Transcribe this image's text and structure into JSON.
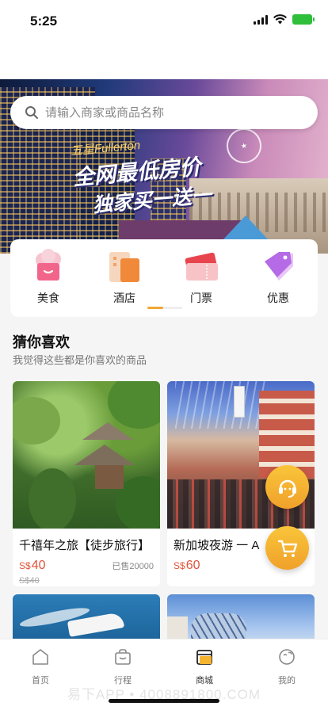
{
  "status": {
    "time": "5:25"
  },
  "banner": {
    "brand": "五星Fullerton",
    "line1": "全网最低房价",
    "line2": "独家买一送一"
  },
  "search": {
    "placeholder": "请输入商家或商品名称"
  },
  "categories": [
    {
      "label": "美食",
      "icon": "food-icon"
    },
    {
      "label": "酒店",
      "icon": "hotel-icon"
    },
    {
      "label": "门票",
      "icon": "ticket-icon"
    },
    {
      "label": "优惠",
      "icon": "coupon-icon"
    }
  ],
  "section": {
    "title": "猜你喜欢",
    "subtitle": "我觉得这些都是你喜欢的商品"
  },
  "products": [
    {
      "title": "千禧年之旅【徒步旅行】",
      "currency": "S$",
      "price": "40",
      "sold": "已售20000",
      "original": "S$40"
    },
    {
      "title": "新加坡夜游 一 A",
      "currency": "S$",
      "price": "60"
    }
  ],
  "tabbar": [
    {
      "label": "首页",
      "icon": "home-icon"
    },
    {
      "label": "行程",
      "icon": "bag-icon"
    },
    {
      "label": "商城",
      "icon": "shop-icon"
    },
    {
      "label": "我的",
      "icon": "profile-icon"
    }
  ],
  "watermark": "易下APP • 4008891800.COM",
  "colors": {
    "accent": "#f0a733",
    "price": "#e0533a"
  }
}
